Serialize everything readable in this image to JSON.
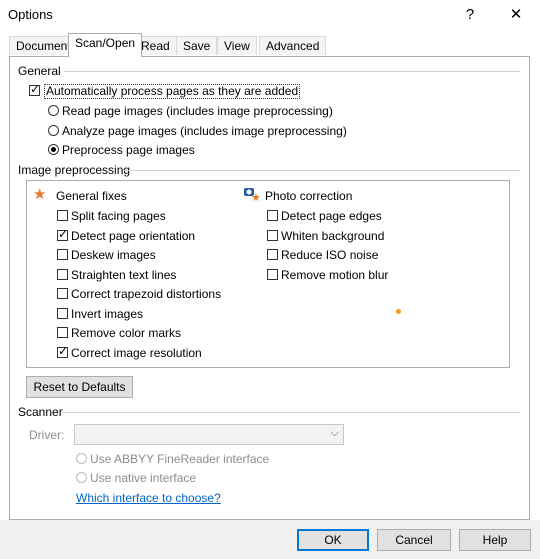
{
  "window": {
    "title": "Options",
    "help_glyph": "?",
    "close_glyph": "✕"
  },
  "tabs": [
    "Document",
    "Scan/Open",
    "Read",
    "Save",
    "View",
    "Advanced"
  ],
  "general": {
    "title": "General",
    "auto_process": {
      "label": "Automatically process pages as they are added",
      "checked": true
    },
    "options": [
      {
        "label": "Read page images (includes image preprocessing)",
        "selected": false
      },
      {
        "label": "Analyze page images (includes image preprocessing)",
        "selected": false
      },
      {
        "label": "Preprocess page images",
        "selected": true
      }
    ]
  },
  "preprocessing": {
    "title": "Image preprocessing",
    "general_fixes": {
      "title": "General fixes",
      "icon": "star-icon",
      "items": [
        {
          "label": "Split facing pages",
          "checked": false
        },
        {
          "label": "Detect page orientation",
          "checked": true
        },
        {
          "label": "Deskew images",
          "checked": false
        },
        {
          "label": "Straighten text lines",
          "checked": false
        },
        {
          "label": "Correct trapezoid distortions",
          "checked": false
        },
        {
          "label": "Invert images",
          "checked": false
        },
        {
          "label": "Remove color marks",
          "checked": false
        },
        {
          "label": "Correct image resolution",
          "checked": true
        }
      ]
    },
    "photo_correction": {
      "title": "Photo correction",
      "icon": "camera-star-icon",
      "items": [
        {
          "label": "Detect page edges",
          "checked": false
        },
        {
          "label": "Whiten background",
          "checked": false
        },
        {
          "label": "Reduce ISO noise",
          "checked": false
        },
        {
          "label": "Remove motion blur",
          "checked": false
        }
      ]
    },
    "reset_label": "Reset to Defaults"
  },
  "scanner": {
    "title": "Scanner",
    "driver_label": "Driver:",
    "driver_value": "",
    "options": [
      {
        "label": "Use ABBYY FineReader interface",
        "selected": true,
        "disabled": true
      },
      {
        "label": "Use native interface",
        "selected": false,
        "disabled": true
      }
    ],
    "help_link": "Which interface to choose?"
  },
  "footer": {
    "ok": "OK",
    "cancel": "Cancel",
    "help": "Help"
  },
  "colors": {
    "accent": "#0078d7",
    "star": "#e8792b",
    "link": "#0066cc"
  }
}
